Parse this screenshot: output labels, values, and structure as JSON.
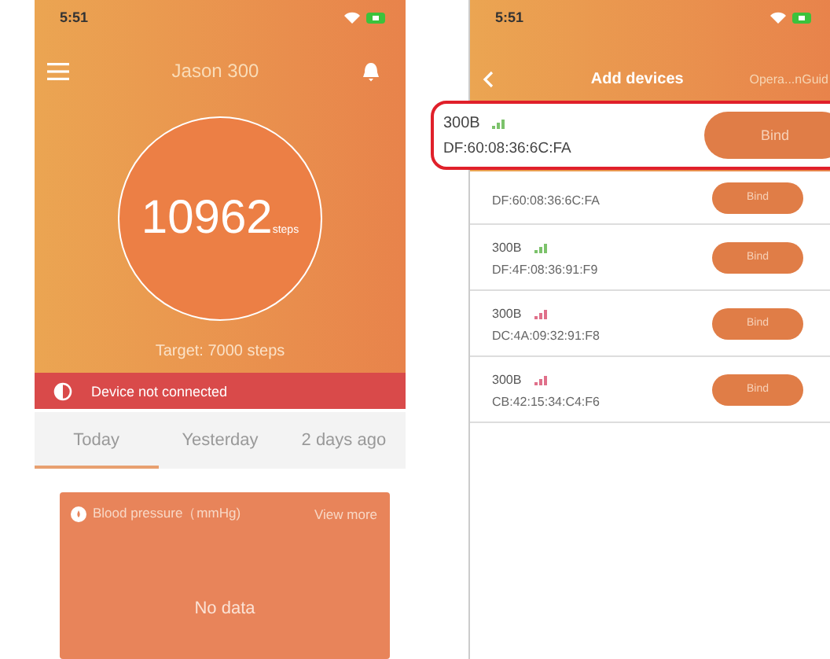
{
  "home_screen": {
    "status_time": "5:51",
    "title": "Jason 300",
    "steps": "10962",
    "steps_unit": "steps",
    "target": "Target: 7000 steps",
    "alert": "Device not connected",
    "tabs": [
      {
        "label": "Today",
        "selected": true
      },
      {
        "label": "Yesterday",
        "selected": false
      },
      {
        "label": "2 days ago",
        "selected": false
      }
    ],
    "card": {
      "title": "Blood pressure（mmHg)",
      "link": "View more",
      "empty": "No data"
    }
  },
  "add_devices_screen": {
    "status_time": "5:51",
    "title": "Add devices",
    "nav_link": "Opera...nGuid",
    "devices": [
      {
        "mac": "DF:60:08:36:6C:FA",
        "button": "Bind"
      },
      {
        "name": "300B",
        "mac": "DF:4F:08:36:91:F9",
        "button": "Bind",
        "color": "#7cc26b"
      },
      {
        "name": "300B",
        "mac": "DC:4A:09:32:91:F8",
        "button": "Bind",
        "color": "#e0708a"
      },
      {
        "name": "300B",
        "mac": "CB:42:15:34:C4:F6",
        "button": "Bind",
        "color": "#e0708a"
      }
    ],
    "callout": {
      "name": "300B",
      "mac": "DF:60:08:36:6C:FA",
      "button": "Bind",
      "color": "#7cc26b"
    }
  }
}
